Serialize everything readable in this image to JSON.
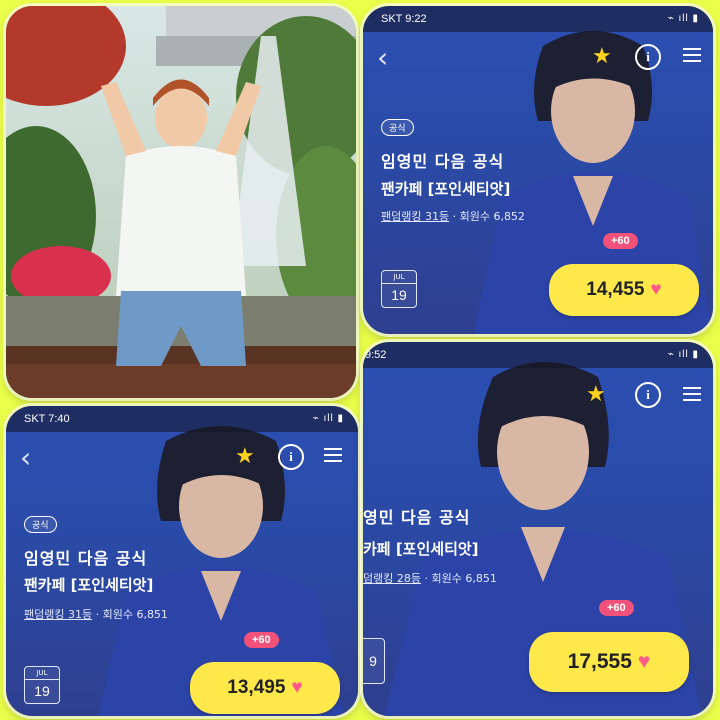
{
  "colors": {
    "frame_bg": "#eaff4a",
    "screen_blue": "#2a4aa6",
    "counter_yellow": "#ffe94a",
    "heart_pink": "#ff5a8a",
    "star_yellow": "#ffd21f",
    "plus_badge": "#f2527a"
  },
  "icons": {
    "back": "chevron-left-icon",
    "favorite": "star-icon",
    "info": "info-icon",
    "menu": "hamburger-menu-icon",
    "like": "heart-icon"
  },
  "screens": [
    {
      "status_time": "SKT 9:22",
      "status_right": "⌁ ıll ▮",
      "badge": "공식",
      "title": "임영민 다음 공식",
      "subtitle": "팬카페 [포인세티앗]",
      "rank_text": "팬덤랭킹 31등",
      "members_text": "· 회원수 6,852",
      "plus": "+60",
      "cal_month": "JUL",
      "cal_day": "19",
      "count": "14,455",
      "heart": "♥"
    },
    {
      "status_time": "SKT 7:40",
      "status_right": "⌁ ıll ▮",
      "badge": "공식",
      "title": "임영민 다음 공식",
      "subtitle": "팬카페 [포인세티앗]",
      "rank_text": "팬덤랭킹 31등",
      "members_text": "· 회원수 6,851",
      "plus": "+60",
      "cal_month": "JUL",
      "cal_day": "19",
      "count": "13,495",
      "heart": "♥"
    },
    {
      "status_time": "9:52",
      "status_right": "⌁ ıll ▮",
      "title": "영민 다음 공식",
      "subtitle": "카페 [포인세티앗]",
      "rank_text": "덤랭킹 28등",
      "members_text": "· 회원수 6,851",
      "plus": "+60",
      "cal_day": "9",
      "count": "17,555",
      "heart": "♥"
    }
  ]
}
